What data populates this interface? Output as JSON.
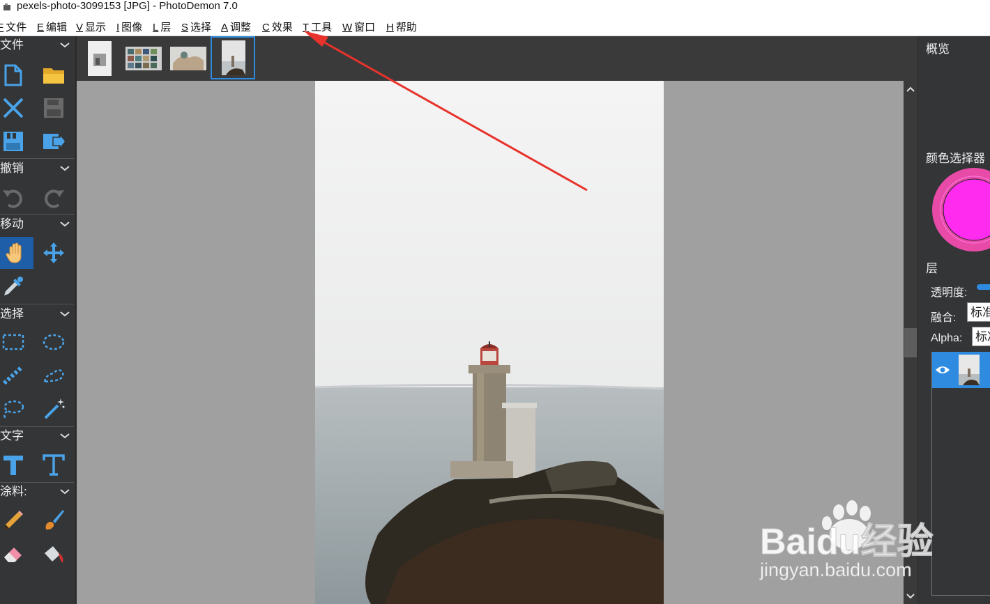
{
  "window": {
    "title": "pexels-photo-3099153 [JPG]  -  PhotoDemon 7.0"
  },
  "menu": [
    {
      "key": "F",
      "label": "文件"
    },
    {
      "key": "E",
      "label": "编辑"
    },
    {
      "key": "V",
      "label": "显示"
    },
    {
      "key": "I",
      "label": "图像"
    },
    {
      "key": "L",
      "label": "层"
    },
    {
      "key": "S",
      "label": "选择"
    },
    {
      "key": "A",
      "label": "调整"
    },
    {
      "key": "C",
      "label": "效果"
    },
    {
      "key": "T",
      "label": "工具"
    },
    {
      "key": "W",
      "label": "窗口"
    },
    {
      "key": "H",
      "label": "帮助"
    }
  ],
  "toolbox": {
    "sections": [
      {
        "label": "文件"
      },
      {
        "label": "撤销"
      },
      {
        "label": "移动"
      },
      {
        "label": "选择"
      },
      {
        "label": "文字"
      },
      {
        "label": "涂料:"
      }
    ],
    "active_tool": "hand-pan-tool",
    "icon_color": "#4aa3e8"
  },
  "thumbnails": [
    {
      "name": "thumbnail-gray-sketch",
      "selected": false
    },
    {
      "name": "thumbnail-photo-grid",
      "selected": false
    },
    {
      "name": "thumbnail-hands",
      "selected": false
    },
    {
      "name": "thumbnail-lighthouse",
      "selected": true
    }
  ],
  "right_panel": {
    "overview_title": "概览",
    "color_picker_title": "颜色选择器",
    "current_color": "#ff2cf0",
    "layers_title": "层",
    "opacity_label": "透明度:",
    "blend_label": "融合:",
    "blend_value": "标准",
    "alpha_label": "Alpha:",
    "alpha_value": "标准"
  },
  "watermark": {
    "brand": "Baidu经验",
    "url": "jingyan.baidu.com"
  },
  "annotation": {
    "color": "#e8322c"
  }
}
